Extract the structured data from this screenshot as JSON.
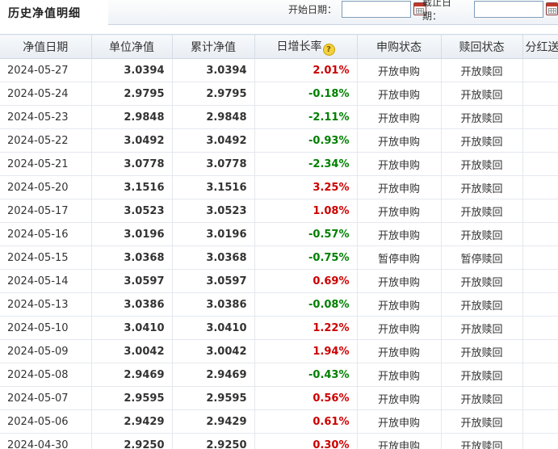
{
  "panel": {
    "title": "历史净值明细",
    "start_label": "开始日期：",
    "start_value": "",
    "end_label": "截止日期：",
    "end_value": ""
  },
  "table": {
    "headers": [
      "净值日期",
      "单位净值",
      "累计净值",
      "日增长率",
      "申购状态",
      "赎回状态",
      "分红送配"
    ],
    "rows": [
      {
        "date": "2024-05-27",
        "nav": "3.0394",
        "acc": "3.0394",
        "rate": "2.01%",
        "trend": "up",
        "buy": "开放申购",
        "redeem": "开放赎回",
        "div": ""
      },
      {
        "date": "2024-05-24",
        "nav": "2.9795",
        "acc": "2.9795",
        "rate": "-0.18%",
        "trend": "down",
        "buy": "开放申购",
        "redeem": "开放赎回",
        "div": ""
      },
      {
        "date": "2024-05-23",
        "nav": "2.9848",
        "acc": "2.9848",
        "rate": "-2.11%",
        "trend": "down",
        "buy": "开放申购",
        "redeem": "开放赎回",
        "div": ""
      },
      {
        "date": "2024-05-22",
        "nav": "3.0492",
        "acc": "3.0492",
        "rate": "-0.93%",
        "trend": "down",
        "buy": "开放申购",
        "redeem": "开放赎回",
        "div": ""
      },
      {
        "date": "2024-05-21",
        "nav": "3.0778",
        "acc": "3.0778",
        "rate": "-2.34%",
        "trend": "down",
        "buy": "开放申购",
        "redeem": "开放赎回",
        "div": ""
      },
      {
        "date": "2024-05-20",
        "nav": "3.1516",
        "acc": "3.1516",
        "rate": "3.25%",
        "trend": "up",
        "buy": "开放申购",
        "redeem": "开放赎回",
        "div": ""
      },
      {
        "date": "2024-05-17",
        "nav": "3.0523",
        "acc": "3.0523",
        "rate": "1.08%",
        "trend": "up",
        "buy": "开放申购",
        "redeem": "开放赎回",
        "div": ""
      },
      {
        "date": "2024-05-16",
        "nav": "3.0196",
        "acc": "3.0196",
        "rate": "-0.57%",
        "trend": "down",
        "buy": "开放申购",
        "redeem": "开放赎回",
        "div": ""
      },
      {
        "date": "2024-05-15",
        "nav": "3.0368",
        "acc": "3.0368",
        "rate": "-0.75%",
        "trend": "down",
        "buy": "暂停申购",
        "redeem": "暂停赎回",
        "div": ""
      },
      {
        "date": "2024-05-14",
        "nav": "3.0597",
        "acc": "3.0597",
        "rate": "0.69%",
        "trend": "up",
        "buy": "开放申购",
        "redeem": "开放赎回",
        "div": ""
      },
      {
        "date": "2024-05-13",
        "nav": "3.0386",
        "acc": "3.0386",
        "rate": "-0.08%",
        "trend": "down",
        "buy": "开放申购",
        "redeem": "开放赎回",
        "div": ""
      },
      {
        "date": "2024-05-10",
        "nav": "3.0410",
        "acc": "3.0410",
        "rate": "1.22%",
        "trend": "up",
        "buy": "开放申购",
        "redeem": "开放赎回",
        "div": ""
      },
      {
        "date": "2024-05-09",
        "nav": "3.0042",
        "acc": "3.0042",
        "rate": "1.94%",
        "trend": "up",
        "buy": "开放申购",
        "redeem": "开放赎回",
        "div": ""
      },
      {
        "date": "2024-05-08",
        "nav": "2.9469",
        "acc": "2.9469",
        "rate": "-0.43%",
        "trend": "down",
        "buy": "开放申购",
        "redeem": "开放赎回",
        "div": ""
      },
      {
        "date": "2024-05-07",
        "nav": "2.9595",
        "acc": "2.9595",
        "rate": "0.56%",
        "trend": "up",
        "buy": "开放申购",
        "redeem": "开放赎回",
        "div": ""
      },
      {
        "date": "2024-05-06",
        "nav": "2.9429",
        "acc": "2.9429",
        "rate": "0.61%",
        "trend": "up",
        "buy": "开放申购",
        "redeem": "开放赎回",
        "div": ""
      },
      {
        "date": "2024-04-30",
        "nav": "2.9250",
        "acc": "2.9250",
        "rate": "0.30%",
        "trend": "up",
        "buy": "开放申购",
        "redeem": "开放赎回",
        "div": ""
      }
    ]
  },
  "colors": {
    "up": "#cc0000",
    "down": "#008000"
  },
  "icons": {
    "help": "question-mark-icon",
    "calendar": "calendar-icon"
  }
}
